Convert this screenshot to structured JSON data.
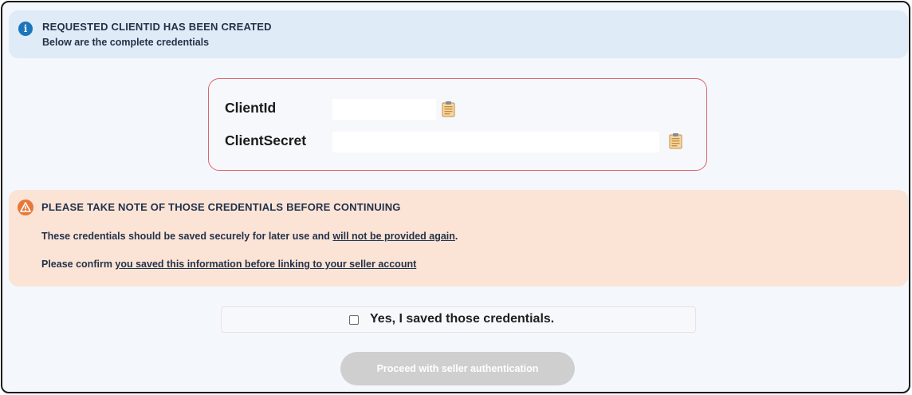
{
  "info_banner": {
    "title": "REQUESTED CLIENTID HAS BEEN CREATED",
    "subtitle": "Below are the complete credentials",
    "icon": "info-icon",
    "color": "#1b75bb"
  },
  "credentials": {
    "client_id_label": "ClientId",
    "client_secret_label": "ClientSecret",
    "copy_icon": "clipboard-icon",
    "border_color": "#dc6470"
  },
  "warning_banner": {
    "title": "PLEASE TAKE NOTE OF THOSE CREDENTIALS BEFORE CONTINUING",
    "line1_prefix": "These credentials should be saved securely for later use and ",
    "line1_link": "will not be provided again",
    "line1_suffix": ".",
    "line2_prefix": "Please confirm ",
    "line2_link": "you saved this information before linking to your seller account",
    "icon": "warning-icon",
    "color": "#e8783a"
  },
  "confirm": {
    "label": "Yes, I saved those credentials.",
    "checked": false
  },
  "proceed_button": {
    "label": "Proceed with seller authentication",
    "disabled": true
  }
}
